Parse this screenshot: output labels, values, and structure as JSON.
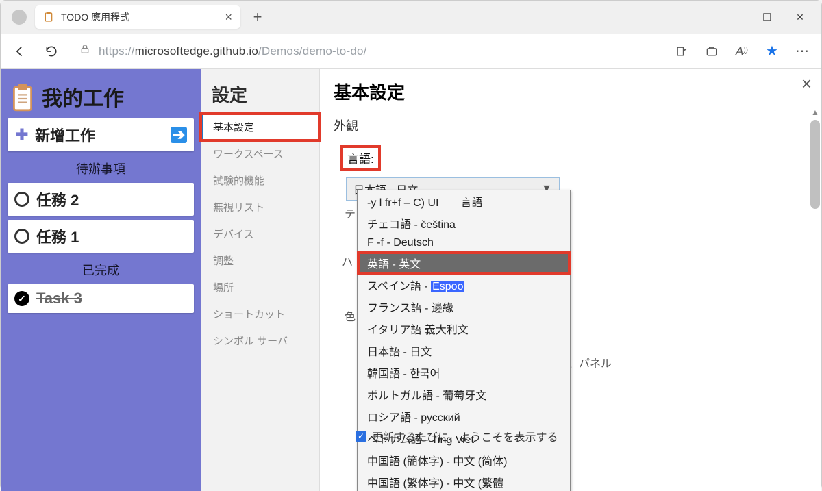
{
  "browser": {
    "tab_title": "TODO 應用程式",
    "url_prefix": "https://",
    "url_host": "microsoftedge.github.io",
    "url_path": "/Demos/demo-to-do/"
  },
  "todo": {
    "title": "我的工作",
    "add_label": "新增工作",
    "pending_label": "待辦事項",
    "done_label": "已完成",
    "tasks": [
      {
        "label": "任務 2"
      },
      {
        "label": "任務 1"
      }
    ],
    "done_tasks": [
      {
        "label": "Task 3"
      }
    ]
  },
  "settings": {
    "heading": "設定",
    "nav": {
      "basic": "基本設定",
      "workspace": "ワークスペース",
      "experimental": "試験的機能",
      "ignorelist": "無視リスト",
      "devices": "デバイス",
      "adjust": "調整",
      "location": "場所",
      "shortcuts": "ショートカット",
      "symbols": "シンボル サーバ"
    },
    "main": {
      "title": "基本設定",
      "appearance": "外観",
      "language_label": "言語:",
      "selected_language": "日本語 - 日文",
      "dropdown": [
        "-y l fr+f – C) UI　　言語",
        "チェコ語 - čeština",
        "F -f - Deutsch",
        "英語 - 英文",
        "スペイン語 - |Espoo|",
        "フランス語   - 邊緣",
        "イタリア語 義大利文",
        "日本語 - 日文",
        "韓国語 - 한국어",
        "ポルトガル語 - 葡萄牙文",
        "ロシア語 - русский",
        "ベトナム語 - Ting Viet",
        "中国語 (簡体字) - 中文 (简体)",
        "中国語 (繁体字) - 中文 (繁體"
      ],
      "ghost_panel": "、パネル",
      "ghost_color": "色",
      "ghost_te": "テ",
      "ghost_ha": "ハ",
      "checkbox_label": "更新するたびに、ようこそを表示する"
    }
  }
}
